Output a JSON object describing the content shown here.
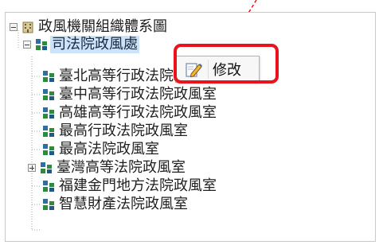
{
  "tree": {
    "root": {
      "label": "政風機關組織體系圖",
      "icon": "building-icon"
    },
    "parent": {
      "label": "司法院政風處",
      "icon": "org-chart-icon"
    },
    "children": [
      {
        "label": "臺北高等行政法院政風室",
        "icon": "org-chart-icon"
      },
      {
        "label": "臺中高等行政法院政風室",
        "icon": "org-chart-icon"
      },
      {
        "label": "高雄高等行政法院政風室",
        "icon": "org-chart-icon"
      },
      {
        "label": "最高行政法院政風室",
        "icon": "org-chart-icon"
      },
      {
        "label": "最高法院政風室",
        "icon": "org-chart-icon"
      },
      {
        "label": "臺灣高等法院政風室",
        "icon": "org-chart-icon",
        "expandable": true
      },
      {
        "label": "福建金門地方法院政風室",
        "icon": "org-chart-icon"
      },
      {
        "label": "智慧財產法院政風室",
        "icon": "org-chart-icon"
      }
    ]
  },
  "context_menu": {
    "items": [
      {
        "label": "修改",
        "icon": "edit-pencil-icon"
      }
    ]
  },
  "colors": {
    "highlight": "#e8131b",
    "selection": "#cde3f7",
    "annotation_line": "#e8131b"
  }
}
